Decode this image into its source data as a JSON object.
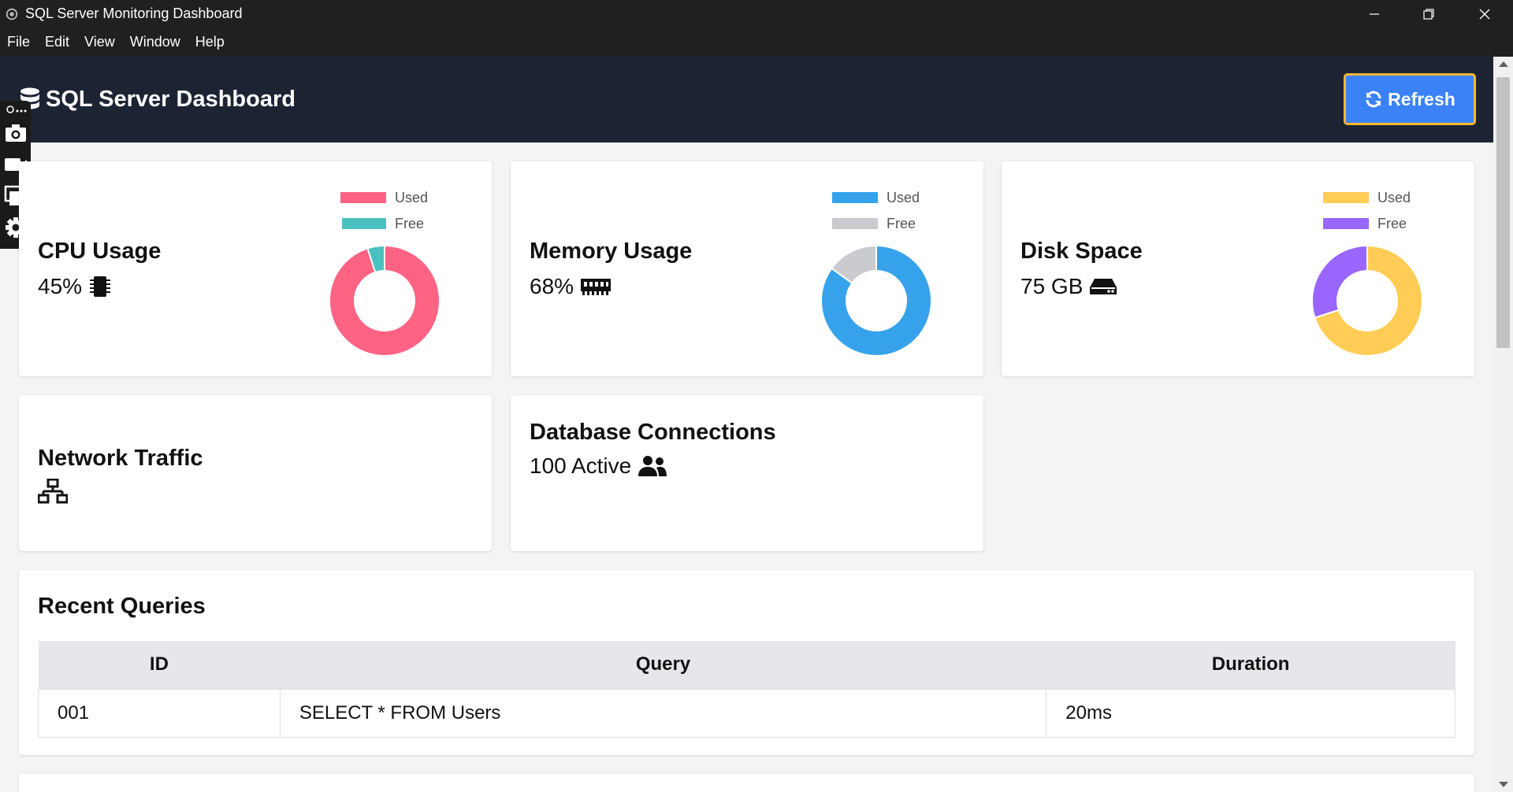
{
  "window": {
    "title": "SQL Server Monitoring Dashboard"
  },
  "menu": [
    "File",
    "Edit",
    "View",
    "Window",
    "Help"
  ],
  "header": {
    "title": "SQL Server Dashboard",
    "refresh_label": "Refresh"
  },
  "cards": {
    "cpu": {
      "title": "CPU Usage",
      "value": "45%",
      "icon": "microchip-icon",
      "legend": [
        {
          "label": "Used",
          "color": "#ff6384"
        },
        {
          "label": "Free",
          "color": "#4bc0c0"
        }
      ]
    },
    "memory": {
      "title": "Memory Usage",
      "value": "68%",
      "icon": "memory-icon",
      "legend": [
        {
          "label": "Used",
          "color": "#36a2eb"
        },
        {
          "label": "Free",
          "color": "#c9cbcf"
        }
      ]
    },
    "disk": {
      "title": "Disk Space",
      "value": "75 GB",
      "icon": "hdd-icon",
      "legend": [
        {
          "label": "Used",
          "color": "#ffcd56"
        },
        {
          "label": "Free",
          "color": "#9966ff"
        }
      ]
    },
    "network": {
      "title": "Network Traffic",
      "icon": "network-icon"
    },
    "connections": {
      "title": "Database Connections",
      "value": "100 Active",
      "icon": "users-icon"
    }
  },
  "chart_data": [
    {
      "type": "pie",
      "series": [
        {
          "name": "CPU Usage",
          "labels": [
            "Used",
            "Free"
          ],
          "values": [
            95,
            5
          ]
        }
      ]
    },
    {
      "type": "pie",
      "series": [
        {
          "name": "Memory Usage",
          "labels": [
            "Used",
            "Free"
          ],
          "values": [
            85,
            15
          ]
        }
      ]
    },
    {
      "type": "pie",
      "series": [
        {
          "name": "Disk Space",
          "labels": [
            "Used",
            "Free"
          ],
          "values": [
            70,
            30
          ]
        }
      ]
    }
  ],
  "queries": {
    "title": "Recent Queries",
    "columns": [
      "ID",
      "Query",
      "Duration"
    ],
    "rows": [
      [
        "001",
        "SELECT * FROM Users",
        "20ms"
      ]
    ]
  }
}
